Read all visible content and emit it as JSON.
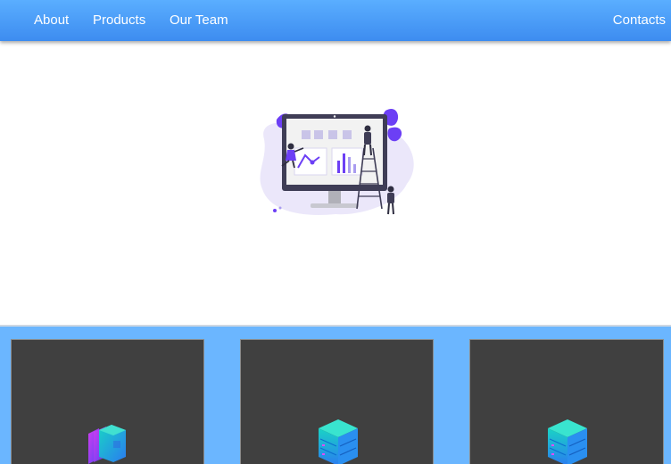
{
  "nav": {
    "about_label": "About",
    "products_label": "Products",
    "team_label": "Our Team",
    "contacts_label": "Contacts"
  },
  "hero": {
    "illustration": "dashboard-analytics-illustration"
  },
  "products": {
    "cards": [
      {
        "icon": "folders-isometric-icon"
      },
      {
        "icon": "server-stack-icon"
      },
      {
        "icon": "server-stack-icon"
      }
    ]
  },
  "colors": {
    "navbar": "#4a9cf8",
    "products_background": "#6bb6ff",
    "card_background": "#404040",
    "accent_purple": "#6c3ff5",
    "accent_teal": "#17d6c0"
  }
}
